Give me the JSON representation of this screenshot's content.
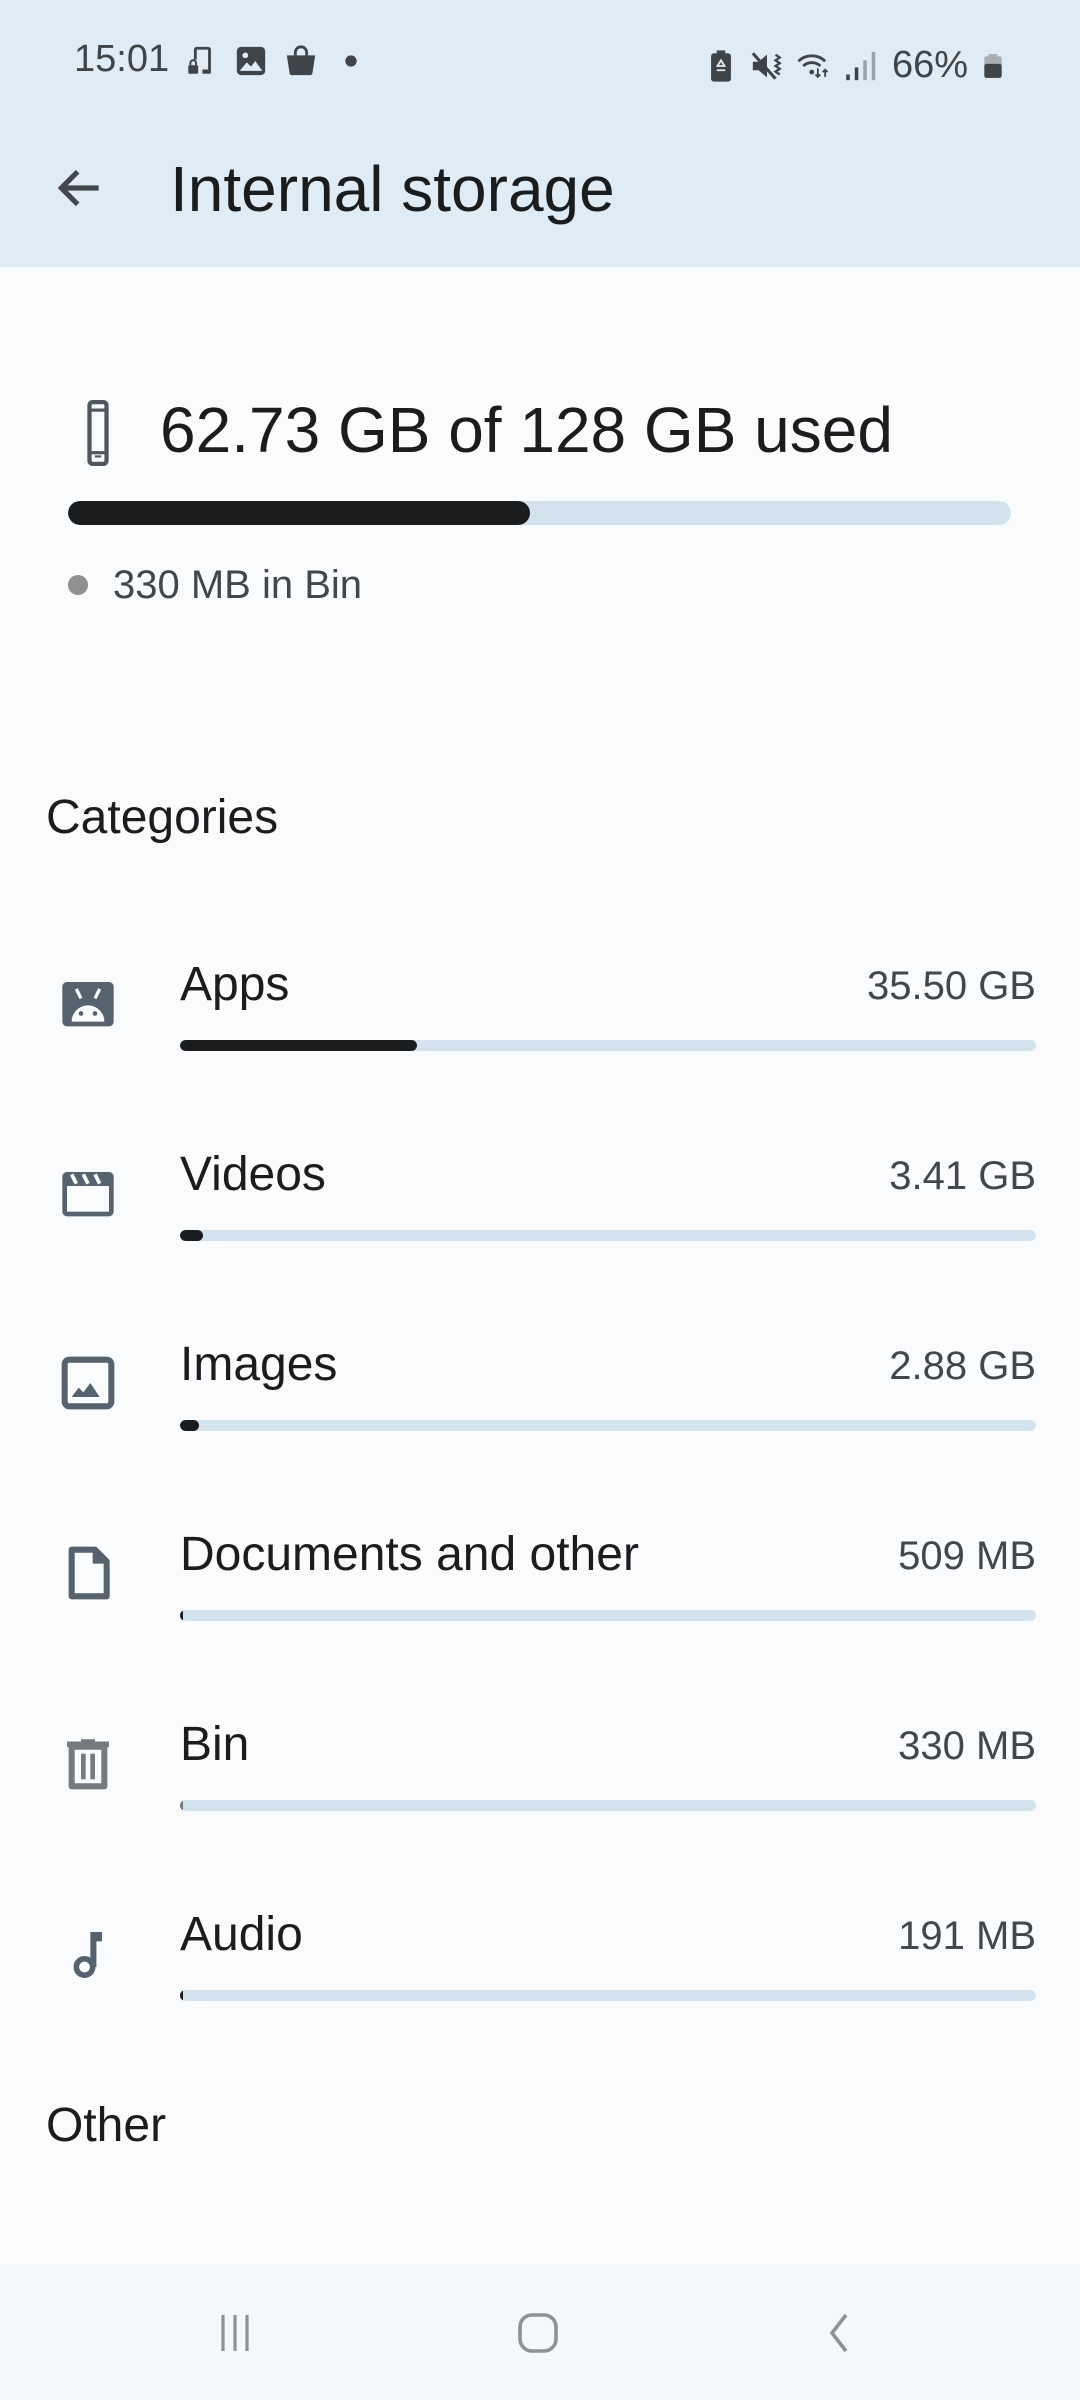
{
  "status_bar": {
    "time": "15:01",
    "left_icons": [
      "phone-lock-icon",
      "image-icon",
      "shopping-bag-icon",
      "dot-icon"
    ],
    "right_icons": [
      "battery-saver-icon",
      "mute-vibrate-icon",
      "wifi-icon",
      "signal-icon"
    ],
    "battery_percent": "66%"
  },
  "app_bar": {
    "back_icon": "arrow-back-icon",
    "title": "Internal storage"
  },
  "summary": {
    "used_text": "62.73 GB of 128 GB used",
    "used_gb": 62.73,
    "total_gb": 128,
    "used_fraction": 0.49,
    "bin_note": "330 MB in Bin"
  },
  "categories": {
    "header": "Categories",
    "items": [
      {
        "label": "Apps",
        "value": "35.50 GB",
        "icon": "android-icon",
        "fraction": 0.277
      },
      {
        "label": "Videos",
        "value": "3.41 GB",
        "icon": "clapperboard-icon",
        "fraction": 0.027
      },
      {
        "label": "Images",
        "value": "2.88 GB",
        "icon": "image-icon",
        "fraction": 0.0225
      },
      {
        "label": "Documents and other",
        "value": "509 MB",
        "icon": "document-icon",
        "fraction": 0.004
      },
      {
        "label": "Bin",
        "value": "330 MB",
        "icon": "trash-icon",
        "fraction": 0.0026
      },
      {
        "label": "Audio",
        "value": "191 MB",
        "icon": "music-note-icon",
        "fraction": 0.0015
      }
    ]
  },
  "other": {
    "header": "Other"
  },
  "nav_bar": {
    "buttons": [
      "recents-button",
      "home-button",
      "back-button"
    ]
  },
  "colors": {
    "header_bg": "#e0ecf5",
    "page_bg": "#fafbfd",
    "bar_track": "#d3e4ee",
    "bar_fill": "#1a1c1e",
    "icon_color": "#56636e"
  }
}
